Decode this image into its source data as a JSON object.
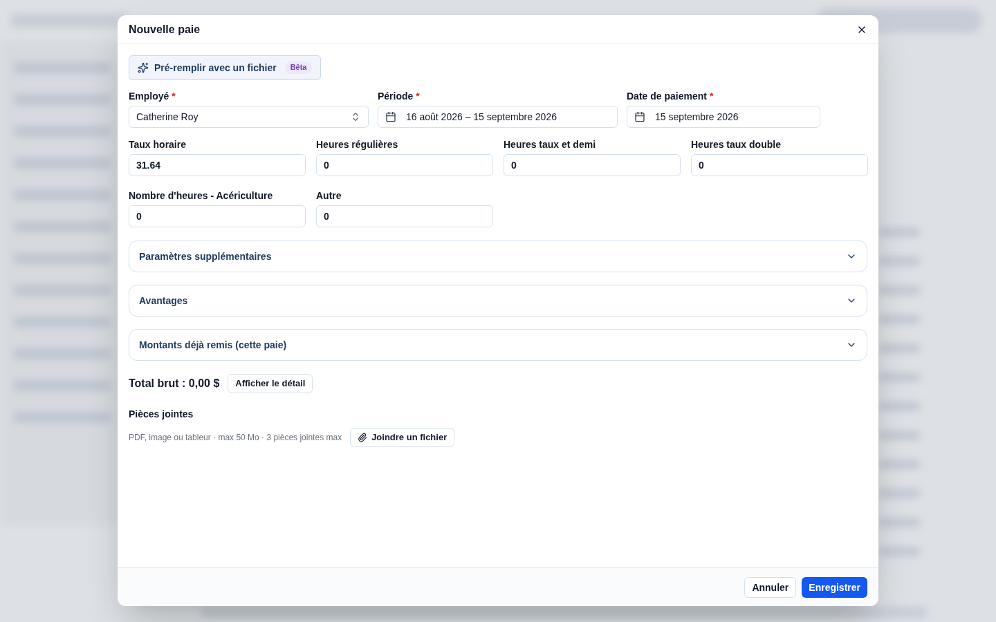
{
  "dialog": {
    "title": "Nouvelle paie"
  },
  "prefill": {
    "label": "Pré-remplir avec un fichier",
    "badge": "Bêta"
  },
  "top_fields": [
    {
      "kind": "select",
      "label": "Employé",
      "required_mark": "*",
      "value": "Catherine Roy"
    },
    {
      "kind": "date",
      "label": "Période",
      "required_mark": "*",
      "value": "16 août 2026 – 15 septembre 2026"
    },
    {
      "kind": "date",
      "label": "Date de paiement",
      "required_mark": "*",
      "value": "15 septembre 2026"
    }
  ],
  "number_fields": [
    {
      "label": "Taux horaire",
      "value": "31.64"
    },
    {
      "label": "Heures régulières",
      "value": "0"
    },
    {
      "label": "Heures taux et demi",
      "value": "0"
    },
    {
      "label": "Heures taux double",
      "value": "0"
    },
    {
      "label": "Nombre d'heures - Acériculture",
      "value": "0"
    },
    {
      "label": "Autre",
      "value": "0"
    }
  ],
  "sections": [
    {
      "title": "Paramètres supplémentaires",
      "expanded": false
    },
    {
      "title": "Avantages",
      "expanded": false
    },
    {
      "title": "Montants déjà remis (cette paie)",
      "expanded": false
    }
  ],
  "total": {
    "text": "Total brut : 0,00 $",
    "button": "Afficher le détail"
  },
  "attachments": {
    "title": "Pièces jointes",
    "hint": "PDF, image ou tableur · max 50 Mo · 3 pièces jointes max",
    "button": "Joindre un fichier"
  },
  "footer": {
    "cancel": "Annuler",
    "save": "Enregistrer"
  }
}
